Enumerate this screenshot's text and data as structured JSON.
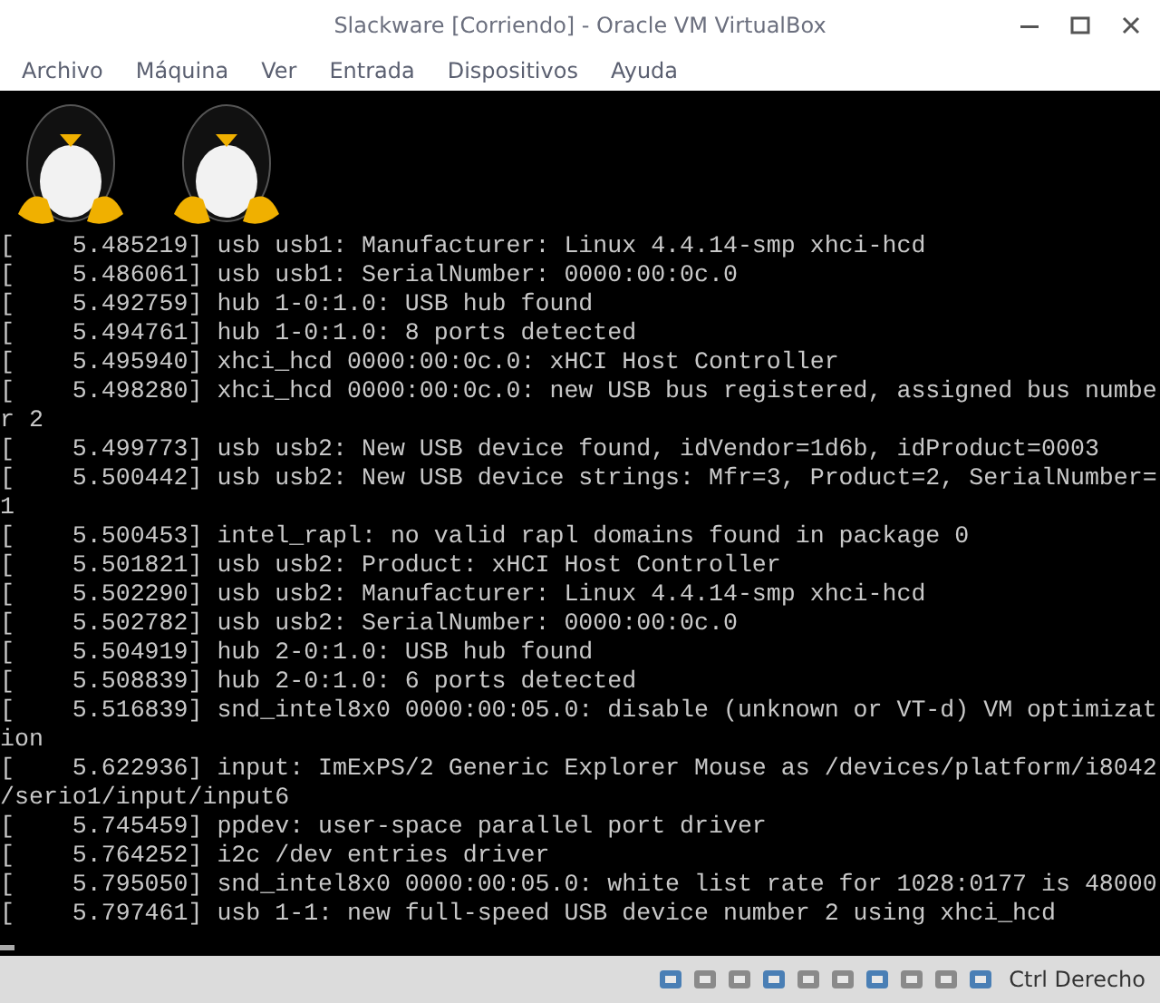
{
  "window": {
    "title": "Slackware [Corriendo] - Oracle VM VirtualBox"
  },
  "menu": [
    "Archivo",
    "Máquina",
    "Ver",
    "Entrada",
    "Dispositivos",
    "Ayuda"
  ],
  "console": {
    "logos": [
      {
        "kind": "penguin"
      },
      {
        "kind": "penguin"
      }
    ],
    "lines": [
      "[    5.485219] usb usb1: Manufacturer: Linux 4.4.14-smp xhci-hcd",
      "[    5.486061] usb usb1: SerialNumber: 0000:00:0c.0",
      "[    5.492759] hub 1-0:1.0: USB hub found",
      "[    5.494761] hub 1-0:1.0: 8 ports detected",
      "[    5.495940] xhci_hcd 0000:00:0c.0: xHCI Host Controller",
      "[    5.498280] xhci_hcd 0000:00:0c.0: new USB bus registered, assigned bus numbe",
      "r 2",
      "[    5.499773] usb usb2: New USB device found, idVendor=1d6b, idProduct=0003",
      "[    5.500442] usb usb2: New USB device strings: Mfr=3, Product=2, SerialNumber=",
      "1",
      "[    5.500453] intel_rapl: no valid rapl domains found in package 0",
      "[    5.501821] usb usb2: Product: xHCI Host Controller",
      "[    5.502290] usb usb2: Manufacturer: Linux 4.4.14-smp xhci-hcd",
      "[    5.502782] usb usb2: SerialNumber: 0000:00:0c.0",
      "[    5.504919] hub 2-0:1.0: USB hub found",
      "[    5.508839] hub 2-0:1.0: 6 ports detected",
      "[    5.516839] snd_intel8x0 0000:00:05.0: disable (unknown or VT-d) VM optimizat",
      "ion",
      "[    5.622936] input: ImExPS/2 Generic Explorer Mouse as /devices/platform/i8042",
      "/serio1/input/input6",
      "[    5.745459] ppdev: user-space parallel port driver",
      "[    5.764252] i2c /dev entries driver",
      "[    5.795050] snd_intel8x0 0000:00:05.0: white list rate for 1028:0177 is 48000",
      "[    5.797461] usb 1-1: new full-speed USB device number 2 using xhci_hcd"
    ]
  },
  "status_bar": {
    "host_key": "Ctrl Derecho"
  }
}
